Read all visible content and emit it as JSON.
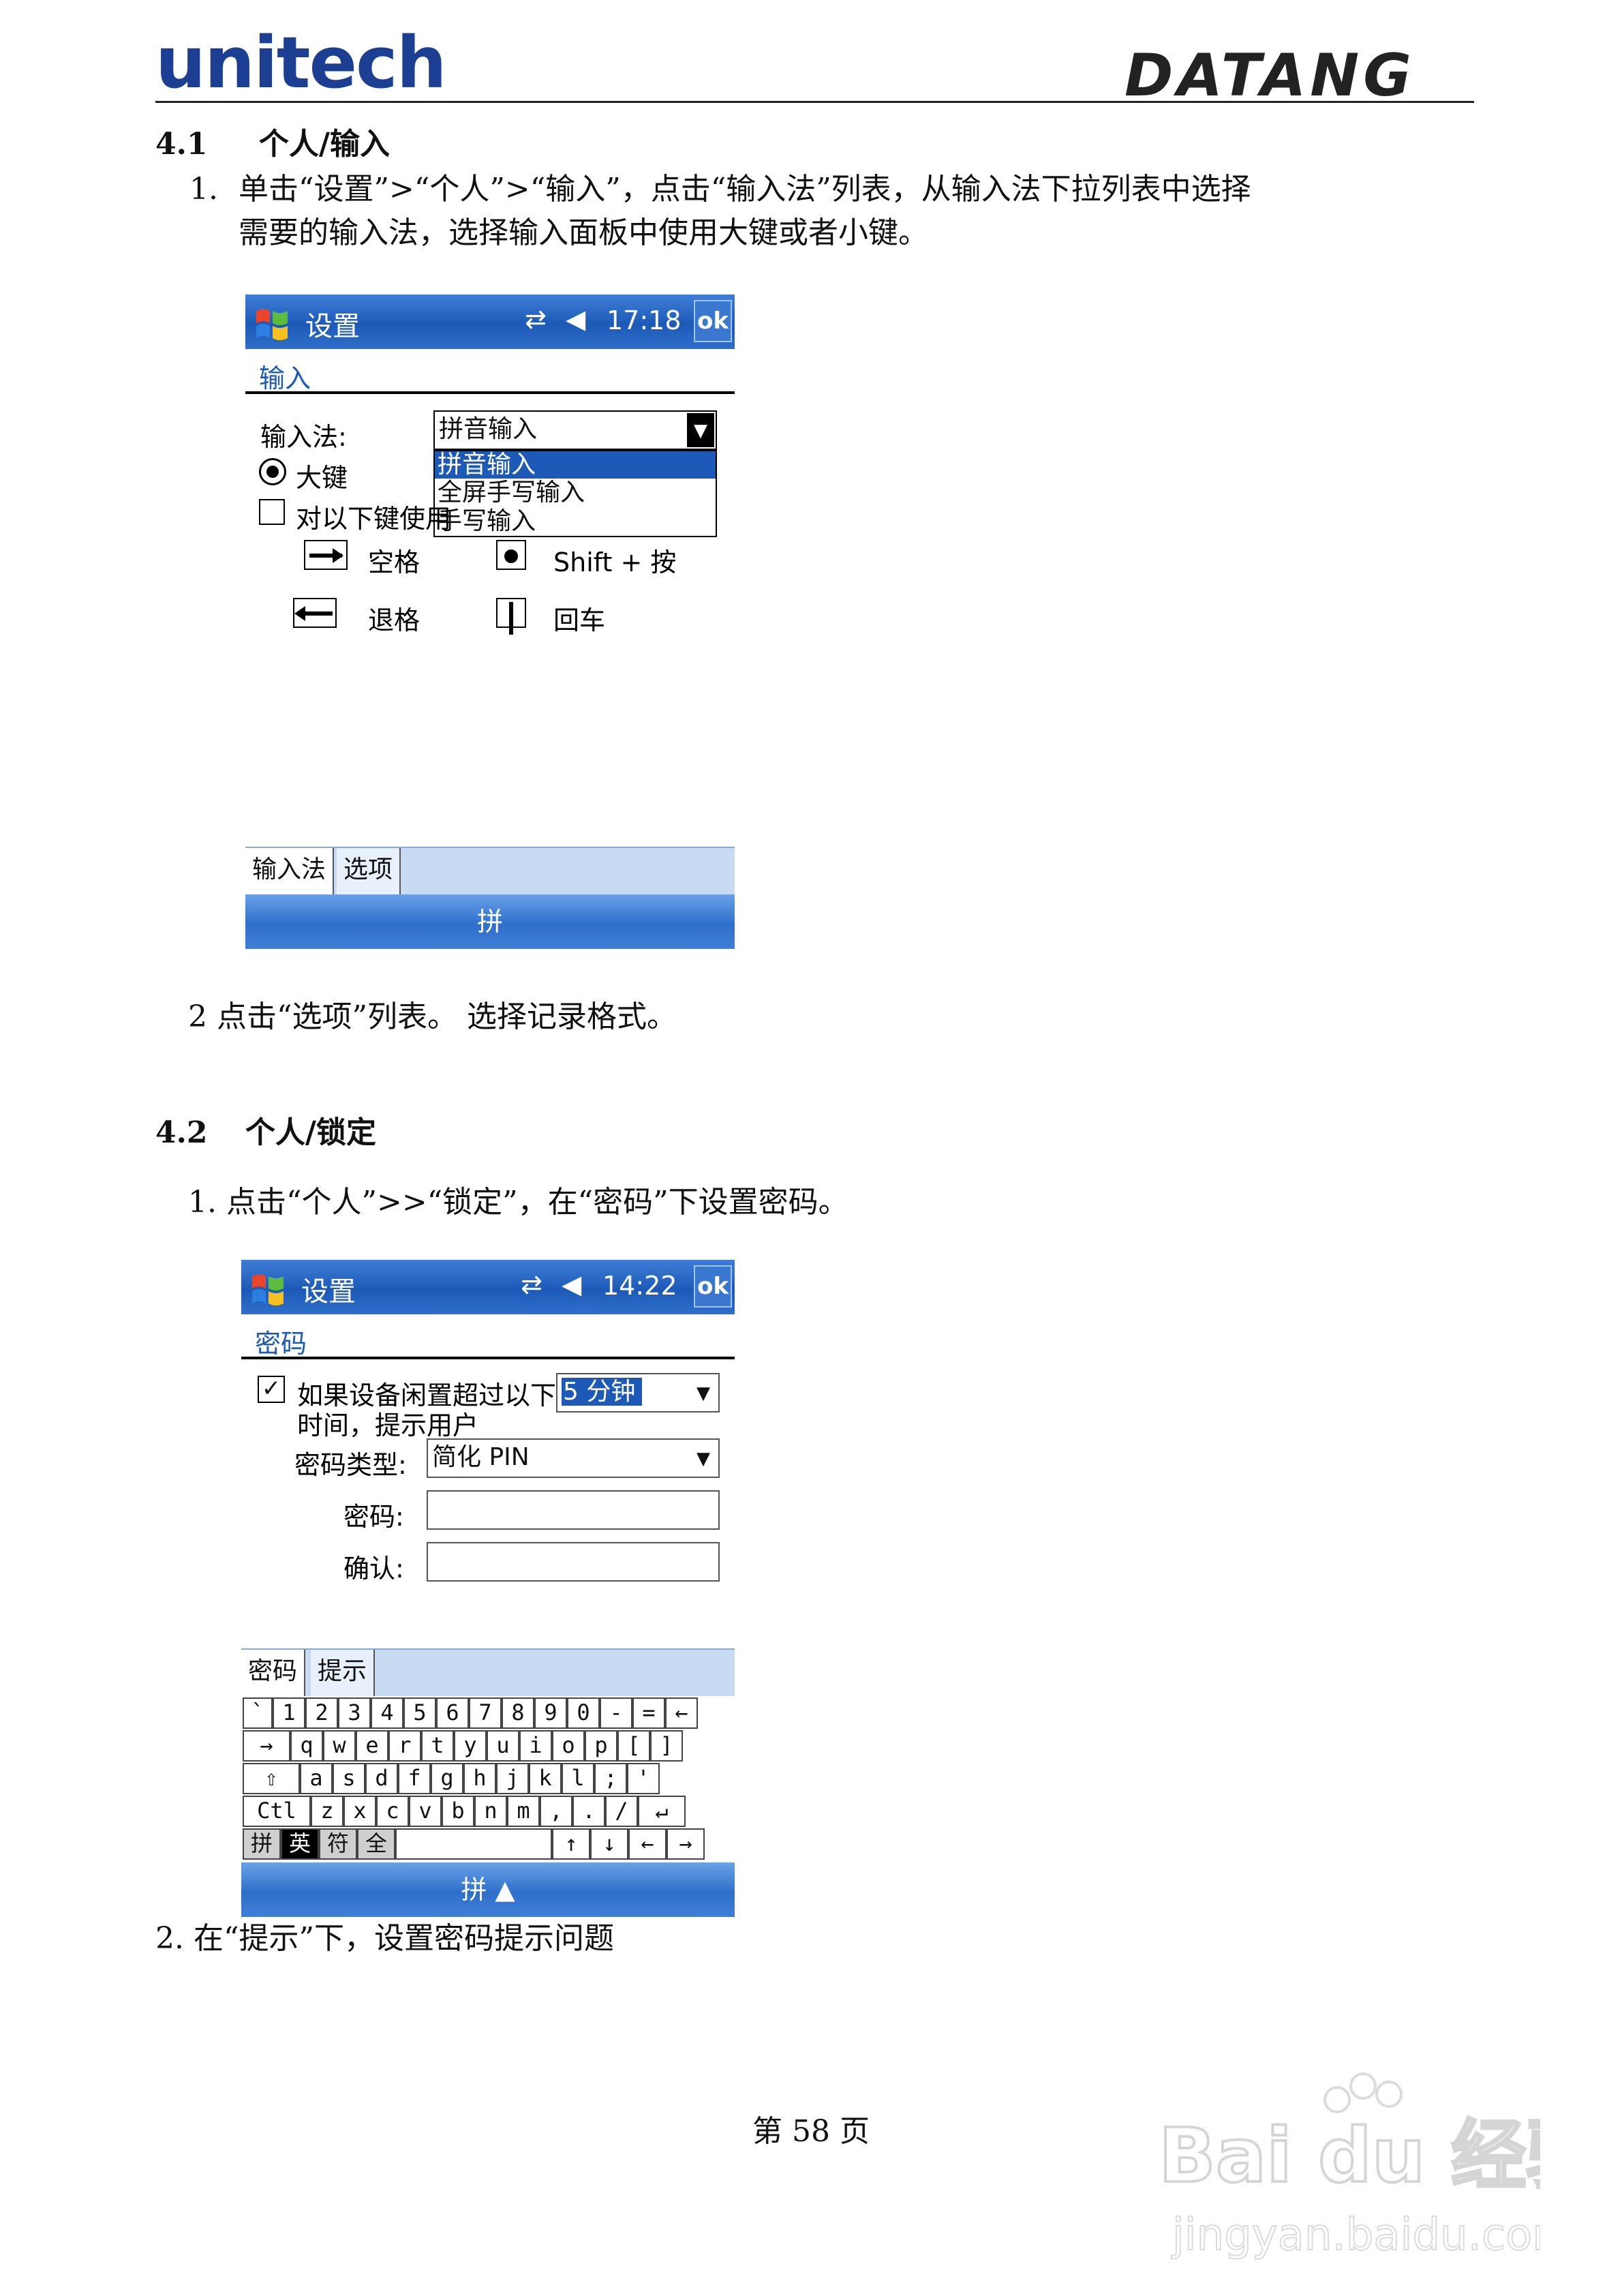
{
  "header": {
    "logo_left": "unitech",
    "logo_right": "DATANG"
  },
  "section41": {
    "heading_num": "4.1",
    "heading_text": "个人/输入",
    "step1_num": "1.",
    "step1_line1": "单击“设置”>“个人”>“输入”，点击“输入法”列表，从输入法下拉列表中选择",
    "step1_line2": "需要的输入法，选择输入面板中使用大键或者小键。",
    "screen": {
      "title": "设置",
      "time": "17:18",
      "ok": "ok",
      "subheading": "输入",
      "input_method_label": "输入法:",
      "input_method_value": "拼音输入",
      "dropdown_options": [
        "拼音输入",
        "全屏手写输入",
        "手写输入"
      ],
      "big_key_label": "大键",
      "checkbox_label": "对以下键使用",
      "gesture_space": "空格",
      "gesture_shift": "Shift + 按",
      "gesture_backspace": "退格",
      "gesture_enter": "回车",
      "tab_input_method": "输入法",
      "tab_options": "选项",
      "sip_label": "拼"
    },
    "step2": "2 点击“选项”列表。 选择记录格式。"
  },
  "section42": {
    "heading_num": "4.2",
    "heading_text": "个人/锁定",
    "step1": "1. 点击“个人”>>“锁定”，在“密码”下设置密码。",
    "screen": {
      "title": "设置",
      "time": "14:22",
      "ok": "ok",
      "subheading": "密码",
      "prompt_line1": "如果设备闲置超过以下",
      "prompt_line2": "时间，提示用户",
      "idle_value": "5 分钟",
      "password_type_label": "密码类型:",
      "password_type_value": "简化 PIN",
      "password_label": "密码:",
      "confirm_label": "确认:",
      "tab_password": "密码",
      "tab_hint": "提示",
      "keyboard": {
        "row1": [
          "`",
          "1",
          "2",
          "3",
          "4",
          "5",
          "6",
          "7",
          "8",
          "9",
          "0",
          "-",
          "=",
          "←"
        ],
        "row2": [
          "→",
          "q",
          "w",
          "e",
          "r",
          "t",
          "y",
          "u",
          "i",
          "o",
          "p",
          "[",
          "]"
        ],
        "row3": [
          "⇧",
          "a",
          "s",
          "d",
          "f",
          "g",
          "h",
          "j",
          "k",
          "l",
          ";",
          "'"
        ],
        "row4": [
          "Ctl",
          "z",
          "x",
          "c",
          "v",
          "b",
          "n",
          "m",
          ",",
          ".",
          "/",
          "↵"
        ],
        "row5": [
          "拼",
          "英",
          "符",
          "全",
          "",
          "↑",
          "↓",
          "←",
          "→"
        ]
      },
      "sip_label": "拼 ▲"
    },
    "step2": "2. 在“提示”下，设置密码提示问题"
  },
  "footer": {
    "page_number": "第 58 页",
    "watermark_line1": "Bai du 经验",
    "watermark_line2": "jingyan.baidu.com"
  },
  "colors": {
    "titlebar": "#1d5ab8",
    "logo_blue": "#1d3f93",
    "tab_bg": "#c9dbf3"
  }
}
